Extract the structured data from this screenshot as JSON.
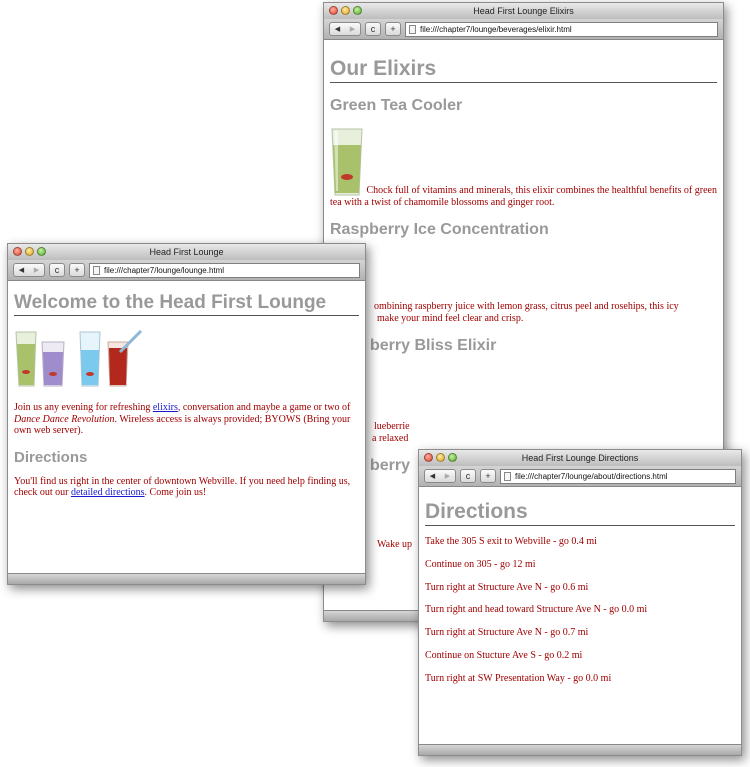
{
  "elixir_window": {
    "title": "Head First Lounge Elixirs",
    "url": "file:///chapter7/lounge/beverages/elixir.html",
    "heading": "Our Elixirs",
    "items": [
      {
        "name": "Green Tea Cooler",
        "description": "Chock full of vitamins and minerals, this elixir combines the healthful benefits of green tea with a twist of chamomile blossoms and ginger root."
      },
      {
        "name": "Raspberry Ice Concentration",
        "description_line1": "ombining raspberry juice with lemon grass, citrus peel and rosehips, this icy",
        "description_line2": "make your mind feel clear and crisp."
      },
      {
        "name": "berry Bliss Elixir",
        "description_line1": "lueberrie",
        "description_line2": "a relaxed"
      },
      {
        "name": "berry",
        "description_line1": "Wake up"
      }
    ]
  },
  "lounge_window": {
    "title": "Head First Lounge",
    "url": "file:///chapter7/lounge/lounge.html",
    "heading": "Welcome to the Head First Lounge",
    "intro_before": "Join us any evening for refreshing ",
    "intro_link": "elixirs",
    "intro_mid": ", conversation and maybe a game or two of ",
    "intro_em": "Dance Dance Revolution",
    "intro_after": ". Wireless access is always provided; BYOWS (Bring your own web server).",
    "directions_heading": "Directions",
    "directions_before": "You'll find us right in the center of downtown Webville. If you need help finding us, check out our ",
    "directions_link": "detailed directions",
    "directions_after": ". Come join us!"
  },
  "directions_window": {
    "title": "Head First Lounge Directions",
    "url": "file:///chapter7/lounge/about/directions.html",
    "heading": "Directions",
    "steps": [
      "Take the 305 S exit to Webville - go 0.4 mi",
      "Continue on 305 - go 12 mi",
      "Turn right at Structure Ave N - go 0.6 mi",
      "Turn right and head toward Structure Ave N - go 0.0 mi",
      "Turn right at Structure Ave N - go 0.7 mi",
      "Continue on Stucture Ave S - go 0.2 mi",
      "Turn right at SW Presentation Way - go 0.0 mi"
    ]
  },
  "toolbar": {
    "back": "◀",
    "forward": "▶",
    "reload": "c",
    "add": "+"
  }
}
